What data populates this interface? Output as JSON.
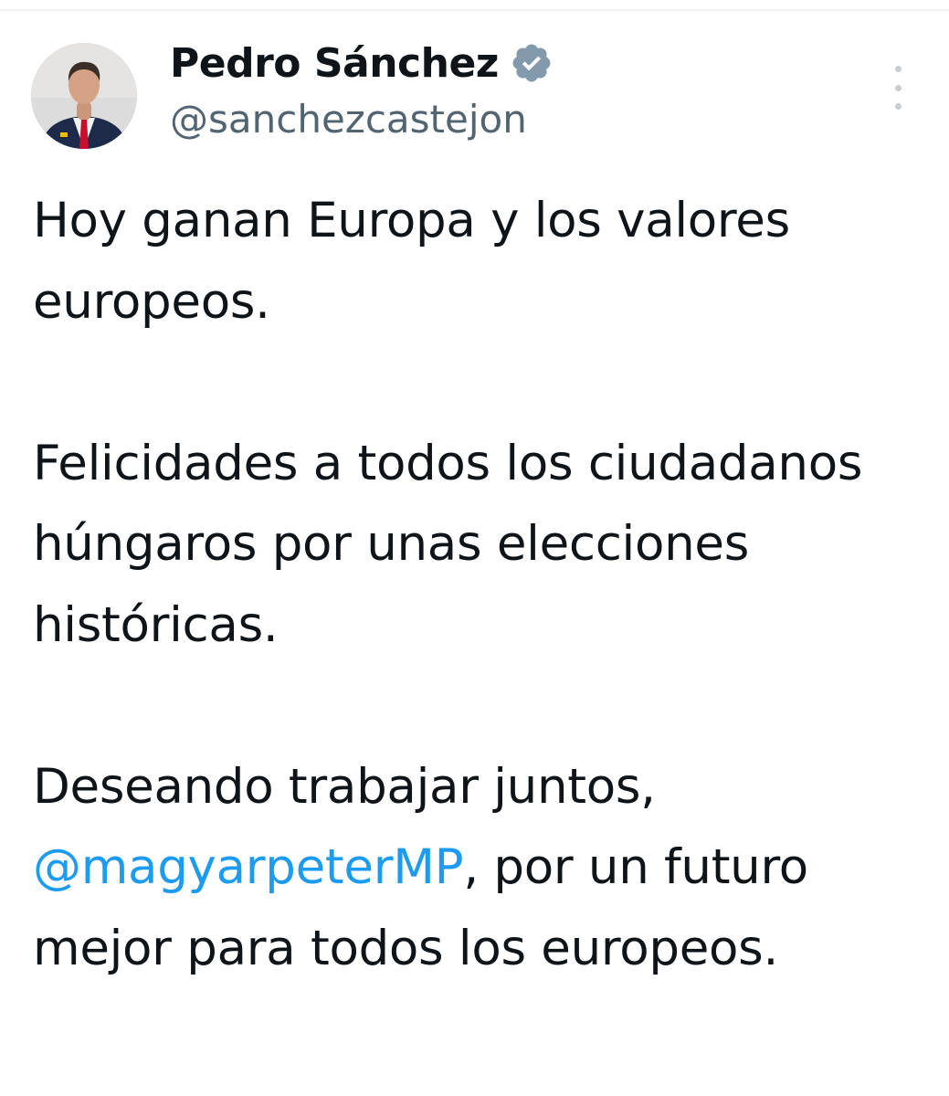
{
  "author": {
    "display_name": "Pedro Sánchez",
    "handle": "@sanchezcastejon",
    "verified_icon": "verified-badge-icon",
    "avatar_icon": "avatar"
  },
  "menu": {
    "icon": "more-options-icon"
  },
  "tweet": {
    "paragraph_1": "Hoy ganan Europa y los valores europeos.",
    "paragraph_2": "Felicidades a todos los ciudadanos húngaros por unas elecciones históricas.",
    "paragraph_3_before": "Deseando trabajar juntos,",
    "mention": "@magyarpeterMP",
    "paragraph_3_after": ", por un futuro mejor para todos los europeos."
  },
  "colors": {
    "text": "#0f1419",
    "secondary": "#536471",
    "link": "#1d9bf0",
    "verified": "#829aab"
  }
}
